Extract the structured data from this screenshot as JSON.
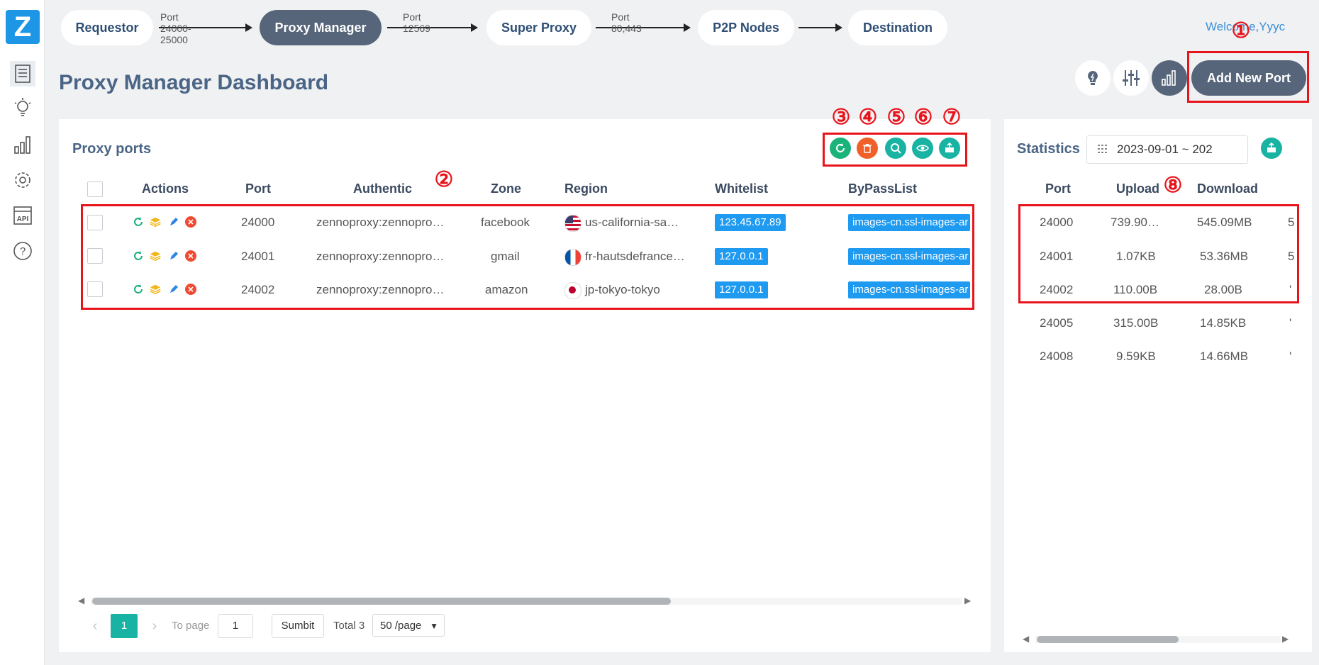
{
  "sidebar": {
    "logo": "Z",
    "items": [
      {
        "icon": "document-list-icon"
      },
      {
        "icon": "lightbulb-icon"
      },
      {
        "icon": "bar-chart-icon"
      },
      {
        "icon": "gear-icon"
      },
      {
        "icon": "api-icon",
        "label": "API"
      },
      {
        "icon": "help-icon"
      }
    ]
  },
  "flow": {
    "steps": [
      "Requestor",
      "Proxy Manager",
      "Super Proxy",
      "P2P Nodes",
      "Destination"
    ],
    "arrow_labels": [
      "Port 24000-25000",
      "Port 12569",
      "Port 80,443",
      ""
    ]
  },
  "header": {
    "welcome": "Welcome,Yyyc",
    "title": "Proxy Manager Dashboard",
    "add_button": "Add New Port"
  },
  "annotations": [
    "①",
    "②",
    "③",
    "④",
    "⑤",
    "⑥",
    "⑦",
    "⑧"
  ],
  "proxy_ports": {
    "title": "Proxy ports",
    "columns": [
      "Actions",
      "Port",
      "Authentic",
      "Zone",
      "Region",
      "Whitelist",
      "ByPassList"
    ],
    "rows": [
      {
        "port": "24000",
        "auth": "zennoproxy:zennopro…",
        "zone": "facebook",
        "region": "us-california-sa…",
        "flag": "us",
        "whitelist": "123.45.67.89",
        "bypass": "images-cn.ssl-images-ar"
      },
      {
        "port": "24001",
        "auth": "zennoproxy:zennopro…",
        "zone": "gmail",
        "region": "fr-hautsdefrance…",
        "flag": "fr",
        "whitelist": "127.0.0.1",
        "bypass": "images-cn.ssl-images-ar"
      },
      {
        "port": "24002",
        "auth": "zennoproxy:zennopro…",
        "zone": "amazon",
        "region": "jp-tokyo-tokyo",
        "flag": "jp",
        "whitelist": "127.0.0.1",
        "bypass": "images-cn.ssl-images-ar"
      }
    ]
  },
  "pagination": {
    "current": "1",
    "to_page_label": "To page",
    "to_page_value": "1",
    "submit": "Sumbit",
    "total": "Total 3",
    "page_size": "50 /page"
  },
  "statistics": {
    "title": "Statistics",
    "date_range": "2023-09-01 ~ 202",
    "columns": [
      "Port",
      "Upload",
      "Download"
    ],
    "rows": [
      {
        "port": "24000",
        "upload": "739.90…",
        "download": "545.09MB",
        "extra": "5"
      },
      {
        "port": "24001",
        "upload": "1.07KB",
        "download": "53.36MB",
        "extra": "5"
      },
      {
        "port": "24002",
        "upload": "110.00B",
        "download": "28.00B",
        "extra": "'"
      },
      {
        "port": "24005",
        "upload": "315.00B",
        "download": "14.85KB",
        "extra": "'"
      },
      {
        "port": "24008",
        "upload": "9.59KB",
        "download": "14.66MB",
        "extra": "'"
      }
    ]
  }
}
